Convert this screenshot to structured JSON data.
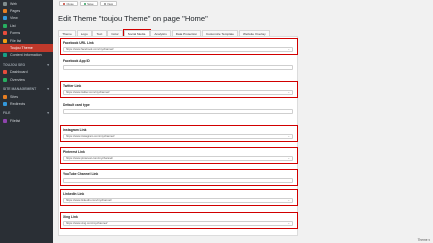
{
  "sidebar": {
    "items_top": [
      {
        "label": "Web",
        "color": "#7f8c8d"
      },
      {
        "label": "Pages",
        "color": "#e67e22"
      },
      {
        "label": "View",
        "color": "#3498db"
      },
      {
        "label": "List",
        "color": "#27ae60"
      },
      {
        "label": "Forms",
        "color": "#e74c3c"
      },
      {
        "label": "File list",
        "color": "#f39c12"
      },
      {
        "label": "Toujou Theme",
        "color": "#c0392b",
        "active": true
      },
      {
        "label": "Content Information",
        "color": "#16a085"
      }
    ],
    "sections": [
      {
        "header": "TOUJOU SEO",
        "items": [
          {
            "label": "Dashboard",
            "color": "#e74c3c"
          },
          {
            "label": "Overview",
            "color": "#27ae60"
          }
        ]
      },
      {
        "header": "SITE MANAGEMENT",
        "items": [
          {
            "label": "Sites",
            "color": "#e67e22"
          },
          {
            "label": "Redirects",
            "color": "#3498db"
          }
        ]
      },
      {
        "header": "FILE",
        "items": [
          {
            "label": "Filelist",
            "color": "#8e44ad"
          }
        ]
      }
    ]
  },
  "toolbar": {
    "close": "Close",
    "save": "Save",
    "view": "View"
  },
  "page_title": "Edit Theme \"toujou Theme\" on page \"Home\"",
  "tabs": [
    {
      "label": "Theme"
    },
    {
      "label": "Logo"
    },
    {
      "label": "Text"
    },
    {
      "label": "Color"
    },
    {
      "label": "Social Media",
      "active": true
    },
    {
      "label": "Analytics"
    },
    {
      "label": "Data Protection"
    },
    {
      "label": "Customize Template"
    },
    {
      "label": "Website Overlay"
    }
  ],
  "fields": [
    {
      "label": "Facebook URL Link",
      "value": "https://www.facebook.com/mychannel/",
      "highlight": true
    },
    {
      "label": "Facebook App ID",
      "value": "",
      "highlight": false
    },
    {
      "label": "Twitter Link",
      "value": "https://www.twitter.com/mychannel/",
      "highlight": true
    },
    {
      "label": "Default card type",
      "value": "",
      "highlight": false
    },
    {
      "label": "Instagram Link",
      "value": "https://www.instagram.com/mychannel/",
      "highlight": true
    },
    {
      "label": "Pinterest Link",
      "value": "https://www.pinterest.com/mychannel/",
      "highlight": true
    },
    {
      "label": "YouTube Channel Link",
      "value": "",
      "highlight": true
    },
    {
      "label": "LinkedIn Link",
      "value": "https://www.linkedin.com/mychannel/",
      "highlight": true
    },
    {
      "label": "Xing Link",
      "value": "https://www.xing.com/mychannel/",
      "highlight": true
    }
  ],
  "footer": {
    "text": "Theme"
  },
  "colors": {
    "sidebar_bg": "#2a2f35",
    "active_item": "#c0392b",
    "highlight": "#d10000"
  }
}
